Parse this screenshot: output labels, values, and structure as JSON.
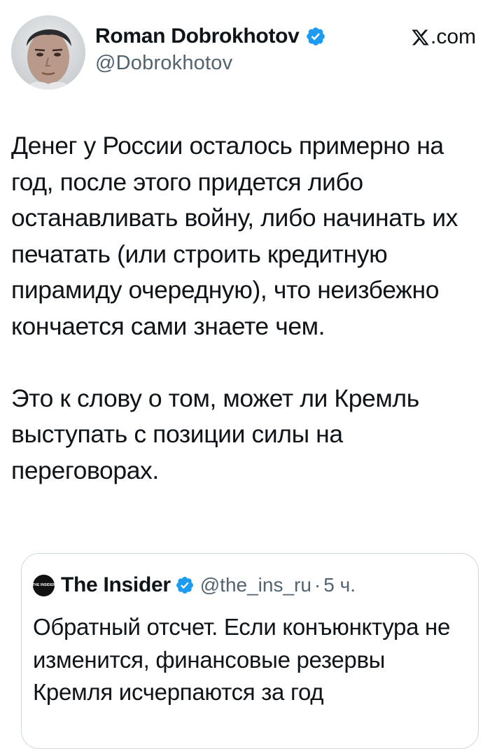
{
  "author": {
    "name": "Roman Dobrokhotov",
    "handle": "@Dobrokhotov",
    "verified": true
  },
  "source": {
    "label": ".com",
    "icon": "x-logo-icon"
  },
  "tweet": {
    "paragraphs": [
      "Денег у России осталось примерно на год, после этого придется либо останавливать войну, либо начинать их печатать (или строить кредитную пирамиду очередную), что неизбежно кончается сами знаете чем.",
      "Это к слову о том, может ли Кремль выступать с позиции силы на переговорах."
    ]
  },
  "quote": {
    "avatar_text": "THE INSIDER",
    "name": "The Insider",
    "verified": true,
    "handle": "@the_ins_ru",
    "separator": "·",
    "time": "5 ч.",
    "text": "Обратный отсчет. Если конъюнктура не изменится, финансовые резервы Кремля исчерпаются за год"
  },
  "colors": {
    "text": "#0f1419",
    "secondary": "#536471",
    "verified": "#1d9bf0",
    "border": "#cfd9de"
  }
}
